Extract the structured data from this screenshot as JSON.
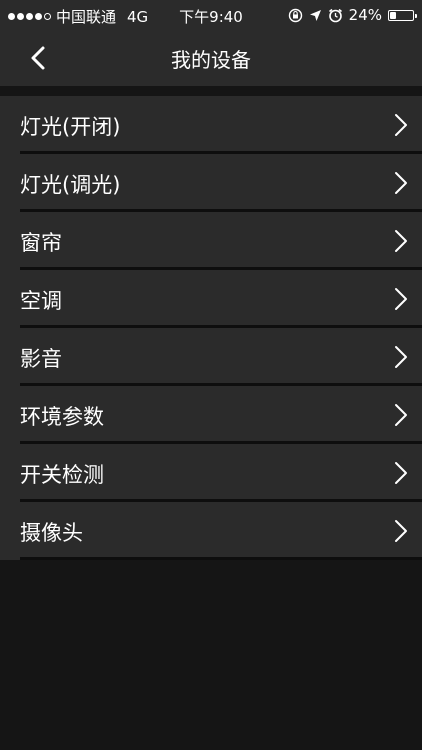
{
  "status_bar": {
    "carrier": "中国联通",
    "network": "4G",
    "time": "下午9:40",
    "battery": "24%",
    "battery_level": 0.24,
    "icons": [
      "signal-icon",
      "orientation-lock-icon",
      "location-icon",
      "alarm-icon",
      "battery-icon"
    ]
  },
  "nav": {
    "title": "我的设备",
    "back_icon": "chevron-left-icon"
  },
  "devices": [
    {
      "label": "灯光(开闭)"
    },
    {
      "label": "灯光(调光)"
    },
    {
      "label": "窗帘"
    },
    {
      "label": "空调"
    },
    {
      "label": "影音"
    },
    {
      "label": "环境参数"
    },
    {
      "label": "开关检测"
    },
    {
      "label": "摄像头"
    }
  ],
  "colors": {
    "background": "#151515",
    "bar": "#2b2b2b",
    "text": "#ffffff",
    "separator": "#0e0e0e"
  }
}
